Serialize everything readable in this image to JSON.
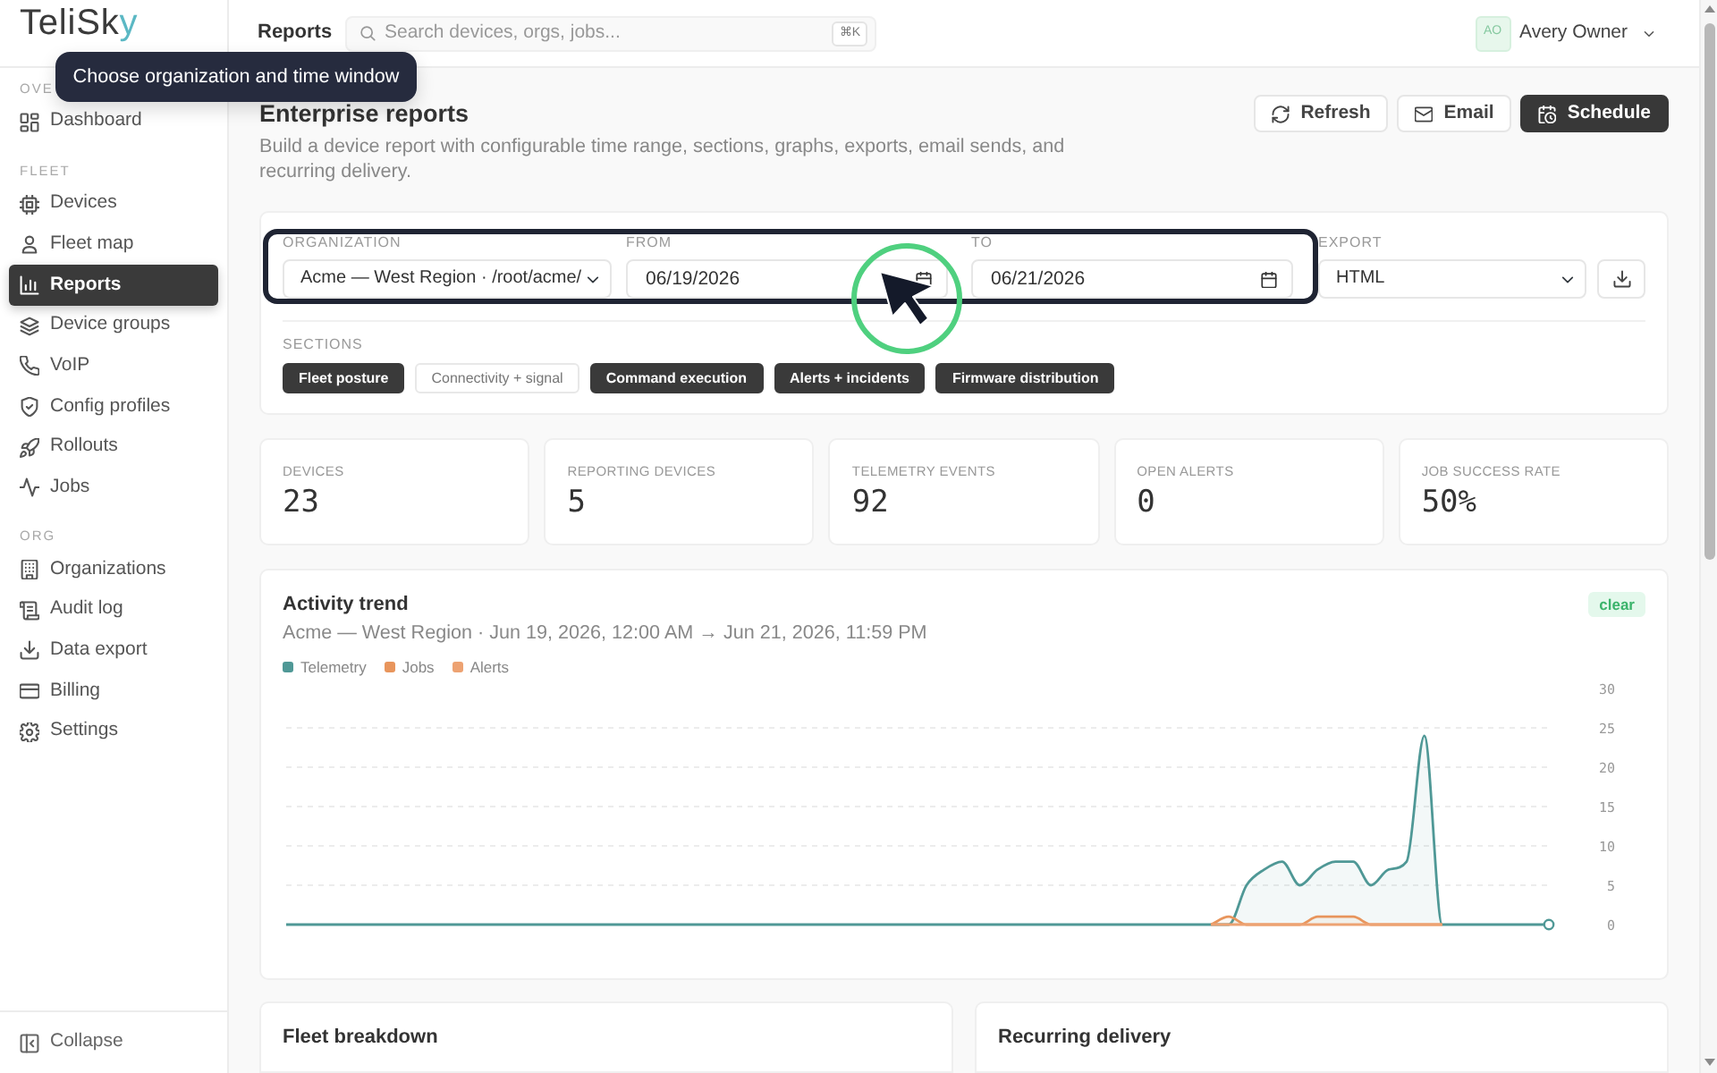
{
  "sidebar": {
    "logo": {
      "text": "TeliSk",
      "accent": "y"
    },
    "sections": [
      {
        "label": "OVE",
        "items": [
          {
            "label": "Dashboard",
            "selected": false
          }
        ]
      },
      {
        "label": "FLEET",
        "items": [
          {
            "label": "Devices",
            "selected": false
          },
          {
            "label": "Fleet map",
            "selected": false
          },
          {
            "label": "Reports",
            "selected": true
          },
          {
            "label": "Device groups",
            "selected": false
          },
          {
            "label": "VoIP",
            "selected": false
          },
          {
            "label": "Config profiles",
            "selected": false
          },
          {
            "label": "Rollouts",
            "selected": false
          },
          {
            "label": "Jobs",
            "selected": false
          }
        ]
      },
      {
        "label": "ORG",
        "items": [
          {
            "label": "Organizations",
            "selected": false
          },
          {
            "label": "Audit log",
            "selected": false
          },
          {
            "label": "Data export",
            "selected": false
          },
          {
            "label": "Billing",
            "selected": false
          },
          {
            "label": "Settings",
            "selected": false
          }
        ]
      }
    ],
    "collapse": "Collapse"
  },
  "header": {
    "title": "Reports",
    "search": {
      "placeholder": "Search devices, orgs, jobs...",
      "shortcut": "⌘K"
    },
    "user": {
      "initials": "AO",
      "name": "Avery Owner"
    }
  },
  "page": {
    "title": "Enterprise reports",
    "subtitle": "Build a device report with configurable time range, sections, graphs, exports, email sends, and recurring delivery.",
    "actions": [
      {
        "label": "Refresh",
        "kind": "outline"
      },
      {
        "label": "Email",
        "kind": "outline"
      },
      {
        "label": "Schedule",
        "kind": "dark"
      }
    ]
  },
  "filters": {
    "fields": [
      {
        "kind": "select",
        "label": "ORGANIZATION",
        "value": "Acme — West Region · /root/acme/"
      },
      {
        "kind": "date",
        "label": "FROM",
        "value": "06/19/2026"
      },
      {
        "kind": "date",
        "label": "TO",
        "value": "06/21/2026"
      },
      {
        "kind": "select",
        "label": "EXPORT",
        "value": "HTML"
      }
    ],
    "sections_label": "SECTIONS",
    "sections": [
      {
        "label": "Fleet posture",
        "selected": true
      },
      {
        "label": "Connectivity + signal",
        "selected": false
      },
      {
        "label": "Command execution",
        "selected": true
      },
      {
        "label": "Alerts + incidents",
        "selected": true
      },
      {
        "label": "Firmware distribution",
        "selected": true
      }
    ]
  },
  "stats": [
    {
      "label": "DEVICES",
      "value": "23"
    },
    {
      "label": "REPORTING DEVICES",
      "value": "5"
    },
    {
      "label": "TELEMETRY EVENTS",
      "value": "92"
    },
    {
      "label": "OPEN ALERTS",
      "value": "0"
    },
    {
      "label": "JOB SUCCESS RATE",
      "value": "50%"
    }
  ],
  "activity": {
    "title": "Activity trend",
    "subtitle": "Acme — West Region · Jun 19, 2026, 12:00 AM → Jun 21, 2026, 11:59 PM",
    "badge": "clear",
    "chart_data": {
      "type": "line",
      "grid": true,
      "categories": [
        null,
        null,
        null,
        null,
        null,
        null,
        null,
        null,
        null,
        null,
        null,
        null,
        null,
        null,
        null,
        null,
        null,
        null,
        null,
        null,
        null,
        null,
        null,
        null,
        null,
        null,
        null,
        null,
        null,
        null,
        null,
        null,
        null,
        null,
        null,
        null,
        null,
        null,
        null,
        null,
        null,
        null,
        null,
        null,
        null,
        null,
        null,
        null,
        null,
        null,
        null,
        null,
        null,
        null,
        null,
        null,
        null,
        null,
        null,
        null,
        null,
        null,
        null,
        null,
        null,
        null,
        null,
        null,
        null,
        null,
        null,
        null
      ],
      "ylim": [
        0,
        30
      ],
      "yticks": [
        0,
        5,
        10,
        15,
        20,
        25,
        30
      ],
      "series": [
        {
          "name": "Telemetry",
          "color": "#4f9896",
          "values": [
            0,
            0,
            0,
            0,
            0,
            0,
            0,
            0,
            0,
            0,
            0,
            0,
            0,
            0,
            0,
            0,
            0,
            0,
            0,
            0,
            0,
            0,
            0,
            0,
            0,
            0,
            0,
            0,
            0,
            0,
            0,
            0,
            0,
            0,
            0,
            0,
            0,
            0,
            0,
            0,
            0,
            0,
            0,
            0,
            0,
            0,
            0,
            0,
            0,
            0,
            0,
            0,
            0,
            0,
            5,
            7,
            8,
            5,
            7,
            8,
            8,
            5,
            7,
            8,
            24,
            0,
            0,
            0,
            0,
            0,
            0,
            0
          ]
        },
        {
          "name": "Jobs",
          "color": "#e8955c",
          "values": [
            null,
            null,
            null,
            null,
            null,
            null,
            null,
            null,
            null,
            null,
            null,
            null,
            null,
            null,
            null,
            null,
            null,
            null,
            null,
            null,
            null,
            null,
            null,
            null,
            null,
            null,
            null,
            null,
            null,
            null,
            null,
            null,
            null,
            null,
            null,
            null,
            null,
            null,
            null,
            null,
            null,
            null,
            null,
            null,
            null,
            null,
            null,
            null,
            null,
            null,
            null,
            null,
            0,
            1,
            0,
            0,
            0,
            0,
            1,
            1,
            1,
            0,
            0,
            0,
            0,
            0,
            null,
            null,
            null,
            null,
            null,
            null
          ]
        },
        {
          "name": "Alerts",
          "color": "#eda272",
          "values": [
            null,
            null,
            null,
            null,
            null,
            null,
            null,
            null,
            null,
            null,
            null,
            null,
            null,
            null,
            null,
            null,
            null,
            null,
            null,
            null,
            null,
            null,
            null,
            null,
            null,
            null,
            null,
            null,
            null,
            null,
            null,
            null,
            null,
            null,
            null,
            null,
            null,
            null,
            null,
            null,
            null,
            null,
            null,
            null,
            null,
            null,
            null,
            null,
            null,
            null,
            null,
            null,
            0,
            0,
            0,
            0,
            0,
            0,
            0,
            0,
            0,
            0,
            0,
            0,
            0,
            0,
            null,
            null,
            null,
            null,
            null,
            null
          ]
        }
      ]
    }
  },
  "panels": [
    {
      "title": "Fleet breakdown"
    },
    {
      "title": "Recurring delivery"
    }
  ],
  "tour": {
    "tooltip": "Choose organization and time window"
  }
}
